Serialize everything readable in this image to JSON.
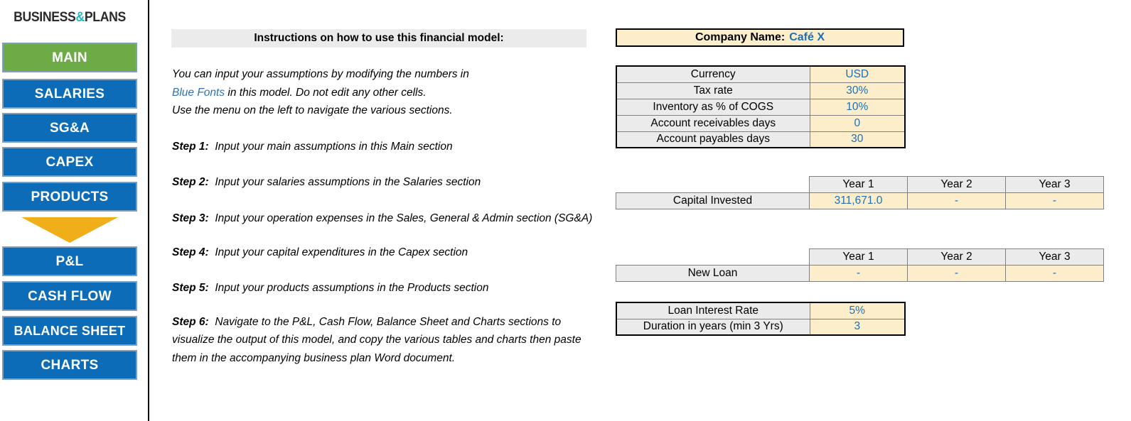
{
  "sidebar": {
    "logo": {
      "part1": "BUSINESS",
      "amp": "&",
      "part2": "PLANS"
    },
    "items": [
      {
        "label": "MAIN",
        "active": true
      },
      {
        "label": "SALARIES",
        "active": false
      },
      {
        "label": "SG&A",
        "active": false
      },
      {
        "label": "CAPEX",
        "active": false
      },
      {
        "label": "PRODUCTS",
        "active": false
      },
      {
        "label": "P&L",
        "active": false
      },
      {
        "label": "CASH FLOW",
        "active": false
      },
      {
        "label": "BALANCE SHEET",
        "active": false
      },
      {
        "label": "CHARTS",
        "active": false
      }
    ],
    "arrow_icon": "down-arrow-icon"
  },
  "instructions": {
    "header": "Instructions on how to use this financial model:",
    "intro_line1": "You can input your assumptions by modifying the numbers in",
    "intro_blue": "Blue Fonts",
    "intro_line2_rest": " in this model. Do not edit any other cells.",
    "intro_line3": "Use the menu on the left to navigate the various sections.",
    "steps": [
      {
        "label": "Step 1:",
        "text": "Input your main assumptions in this Main section"
      },
      {
        "label": "Step 2:",
        "text": "Input your salaries assumptions in the Salaries section"
      },
      {
        "label": "Step 3:",
        "text": "Input your operation expenses in the Sales, General & Admin section (SG&A)"
      },
      {
        "label": "Step 4:",
        "text": "Input your capital expenditures in the Capex section"
      },
      {
        "label": "Step 5:",
        "text": "Input your products assumptions in the Products section"
      },
      {
        "label": "Step 6:",
        "text": "Navigate to the P&L, Cash Flow, Balance Sheet and Charts sections to visualize the output of this model, and copy the various tables and charts then paste them in the accompanying business plan Word document."
      }
    ]
  },
  "main": {
    "company": {
      "label": "Company Name:",
      "value": "Café X"
    },
    "assumptions": [
      {
        "label": "Currency",
        "value": "USD"
      },
      {
        "label": "Tax rate",
        "value": "30%"
      },
      {
        "label": "Inventory as % of COGS",
        "value": "10%"
      },
      {
        "label": "Account receivables days",
        "value": "0"
      },
      {
        "label": "Account payables days",
        "value": "30"
      }
    ],
    "year_headers": [
      "Year 1",
      "Year 2",
      "Year 3"
    ],
    "capital_invested": {
      "label": "Capital Invested",
      "values": [
        "311,671.0",
        "-",
        "-"
      ]
    },
    "new_loan": {
      "label": "New Loan",
      "values": [
        "-",
        "-",
        "-"
      ]
    },
    "loan_terms": [
      {
        "label": "Loan Interest Rate",
        "value": "5%"
      },
      {
        "label": "Duration in years (min 3 Yrs)",
        "value": "3"
      }
    ]
  },
  "colors": {
    "nav_blue": "#0d6cb8",
    "nav_active_green": "#6cab45",
    "arrow_gold": "#f0ae18",
    "input_blue_font": "#1f6fb5",
    "input_cell_bg": "#fdeecb",
    "label_cell_bg": "#ebebeb",
    "logo_amp_teal": "#2ab6c4"
  }
}
